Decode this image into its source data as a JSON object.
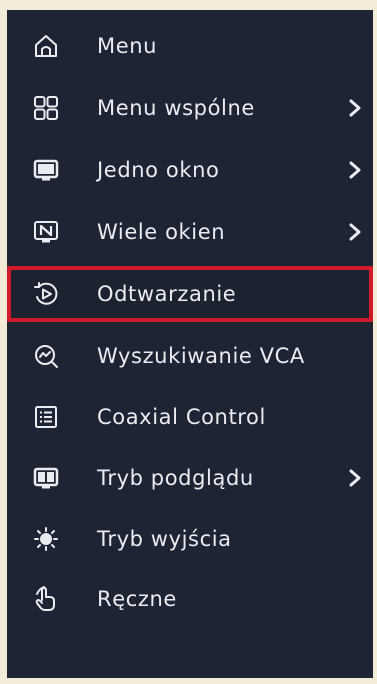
{
  "menu": {
    "items": [
      {
        "label": "Menu",
        "icon": "home-icon",
        "submenu": false
      },
      {
        "label": "Menu wspólne",
        "icon": "grid-icon",
        "submenu": true
      },
      {
        "label": "Jedno okno",
        "icon": "monitor-icon",
        "submenu": true
      },
      {
        "label": "Wiele okien",
        "icon": "multi-window-icon",
        "submenu": true
      },
      {
        "label": "Odtwarzanie",
        "icon": "playback-icon",
        "submenu": false,
        "selected": true
      },
      {
        "label": "Wyszukiwanie VCA",
        "icon": "vca-search-icon",
        "submenu": false
      },
      {
        "label": "Coaxial Control",
        "icon": "list-icon",
        "submenu": false
      },
      {
        "label": "Tryb podglądu",
        "icon": "preview-mode-icon",
        "submenu": true
      },
      {
        "label": "Tryb wyjścia",
        "icon": "output-mode-icon",
        "submenu": false
      },
      {
        "label": "Ręczne",
        "icon": "hand-icon",
        "submenu": false
      }
    ]
  },
  "colors": {
    "background": "#1e2433",
    "text": "#e9ecf1",
    "selection_border": "#d21b2a"
  }
}
